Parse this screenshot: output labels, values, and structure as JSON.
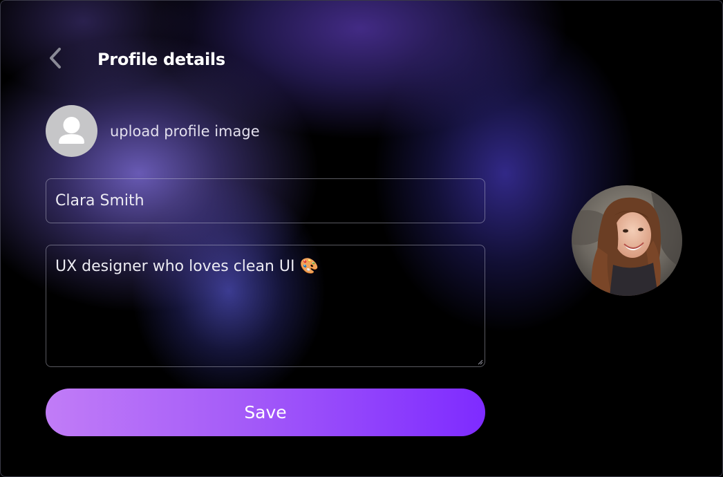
{
  "header": {
    "title": "Profile details",
    "back_icon": "chevron-left-icon"
  },
  "upload": {
    "label": "upload profile image",
    "icon": "user-icon"
  },
  "form": {
    "name_value": "Clara Smith",
    "bio_value": "UX designer who loves clean UI 🎨"
  },
  "actions": {
    "save_label": "Save"
  },
  "colors": {
    "button_gradient_start": "#c17cf7",
    "button_gradient_end": "#7e2bff",
    "field_border": "#8c8c9e",
    "avatar_placeholder": "#c6c6c8"
  }
}
